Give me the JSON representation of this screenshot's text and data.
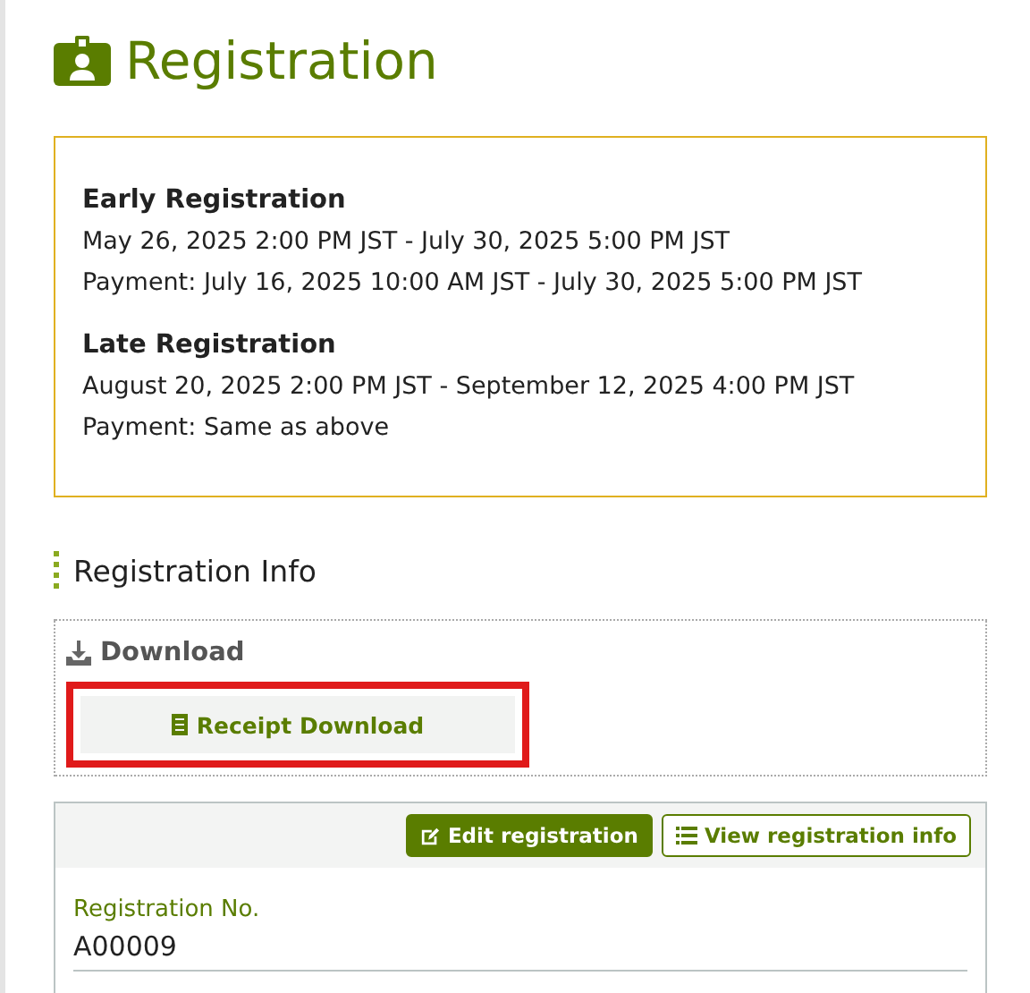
{
  "page_title": "Registration",
  "notice": {
    "periods": [
      {
        "heading": "Early Registration",
        "lines": [
          "May 26, 2025 2:00 PM JST - July 30, 2025 5:00 PM JST",
          "Payment: July 16, 2025 10:00 AM JST - July 30, 2025 5:00 PM JST"
        ]
      },
      {
        "heading": "Late Registration",
        "lines": [
          "August 20, 2025 2:00 PM JST - September 12, 2025 4:00 PM JST",
          "Payment: Same as above"
        ]
      }
    ]
  },
  "section_title": "Registration Info",
  "download": {
    "heading": "Download",
    "button": "Receipt Download",
    "highlighted": true
  },
  "card": {
    "actions": [
      {
        "kind": "edit",
        "label": "Edit registration"
      },
      {
        "kind": "view",
        "label": "View registration info"
      }
    ],
    "fields": [
      {
        "label": "Registration No.",
        "value": "A00009"
      }
    ]
  }
}
